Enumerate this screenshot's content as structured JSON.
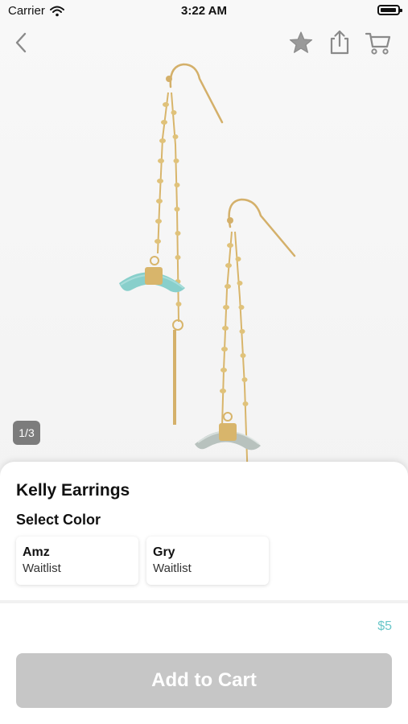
{
  "status_bar": {
    "carrier": "Carrier",
    "time": "3:22 AM"
  },
  "nav": {
    "back_icon": "chevron-left-icon",
    "favorite_icon": "star-icon",
    "share_icon": "share-icon",
    "cart_icon": "cart-icon"
  },
  "gallery": {
    "counter": "1/3"
  },
  "product": {
    "title": "Kelly Earrings",
    "select_label": "Select Color",
    "colors": [
      {
        "name": "Amz",
        "status": "Waitlist"
      },
      {
        "name": "Gry",
        "status": "Waitlist"
      }
    ],
    "price": "$5"
  },
  "actions": {
    "add_to_cart": "Add to Cart"
  },
  "colors": {
    "accent_price": "#6ac7c9",
    "disabled_button": "#c6c6c6",
    "stone_teal": "#88cfcb",
    "stone_gray": "#b8c2be",
    "gold": "#d8b56b"
  }
}
